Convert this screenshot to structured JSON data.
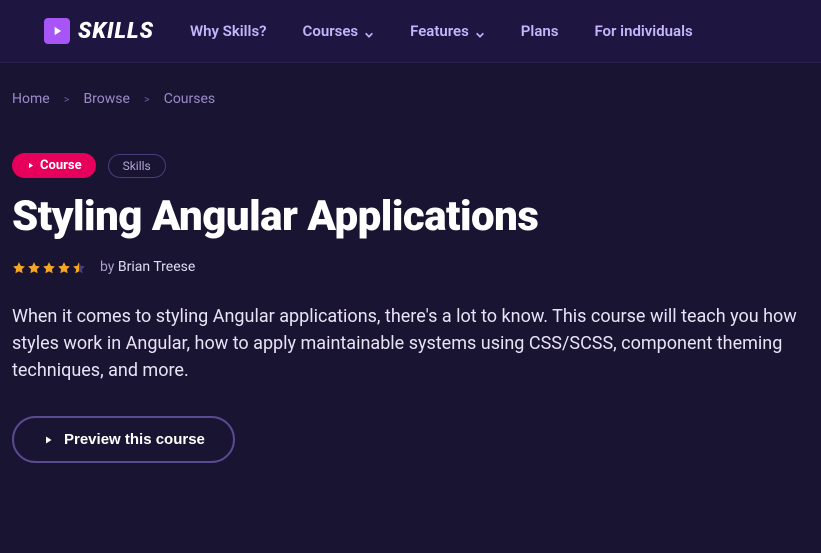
{
  "brand": "SKILLS",
  "nav": {
    "why": "Why Skills?",
    "courses": "Courses",
    "features": "Features",
    "plans": "Plans",
    "individuals": "For individuals"
  },
  "breadcrumb": {
    "home": "Home",
    "browse": "Browse",
    "courses": "Courses"
  },
  "tags": {
    "course": "Course",
    "skills": "Skills"
  },
  "course": {
    "title": "Styling Angular Applications",
    "author_prefix": "by",
    "author": "Brian Treese",
    "rating": 4.5,
    "description": "When it comes to styling Angular applications, there's a lot to know. This course will teach you how styles work in Angular, how to apply maintainable systems using CSS/SCSS, component theming techniques, and more."
  },
  "actions": {
    "preview": "Preview this course"
  }
}
